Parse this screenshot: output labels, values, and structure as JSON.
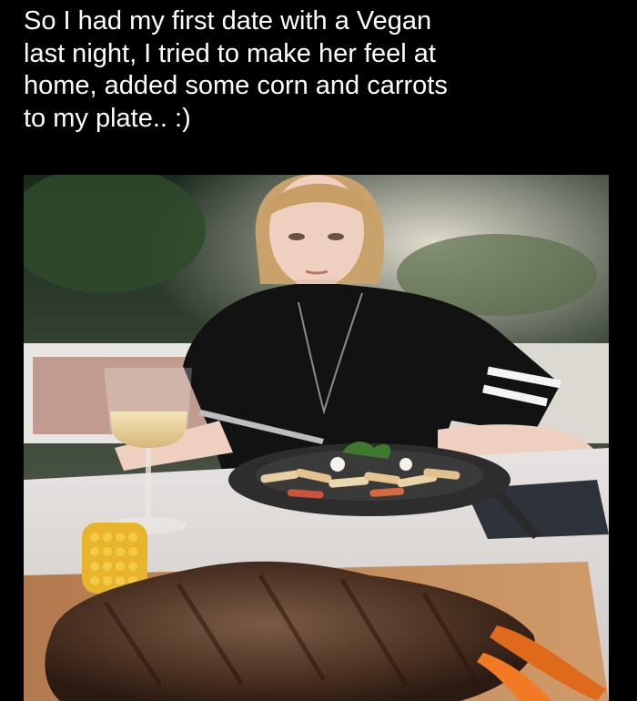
{
  "caption": "So I had my first date with a Vegan\nlast night, I tried to make her feel at\nhome, added some corn and carrots\nto my plate.. :)",
  "colors": {
    "background": "#000000",
    "caption_text": "#ffffff"
  },
  "photo": {
    "subject": "woman-at-table",
    "items": [
      "pasta-plate",
      "wine-glass",
      "corn-cob",
      "steak",
      "carrots",
      "knife",
      "fork"
    ]
  }
}
